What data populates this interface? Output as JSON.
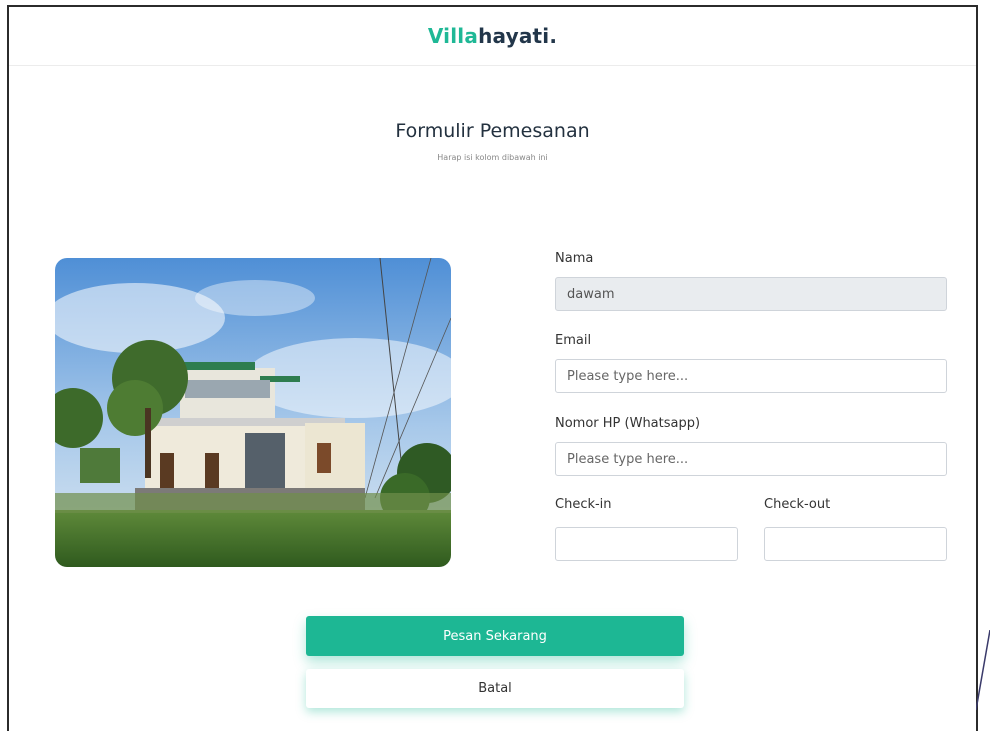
{
  "brand": {
    "accent": "Villa",
    "rest": "hayati."
  },
  "heading": {
    "title": "Formulir Pemesanan",
    "subtitle": "Harap isi kolom dibawah ini"
  },
  "form": {
    "name_label": "Nama",
    "name_value": "dawam",
    "email_label": "Email",
    "email_placeholder": "Please type here...",
    "phone_label": "Nomor HP (Whatsapp)",
    "phone_placeholder": "Please type here...",
    "checkin_label": "Check-in",
    "checkout_label": "Check-out"
  },
  "buttons": {
    "submit": "Pesan Sekarang",
    "cancel": "Batal"
  },
  "colors": {
    "accent": "#1db794",
    "brand_dark": "#22364a"
  }
}
